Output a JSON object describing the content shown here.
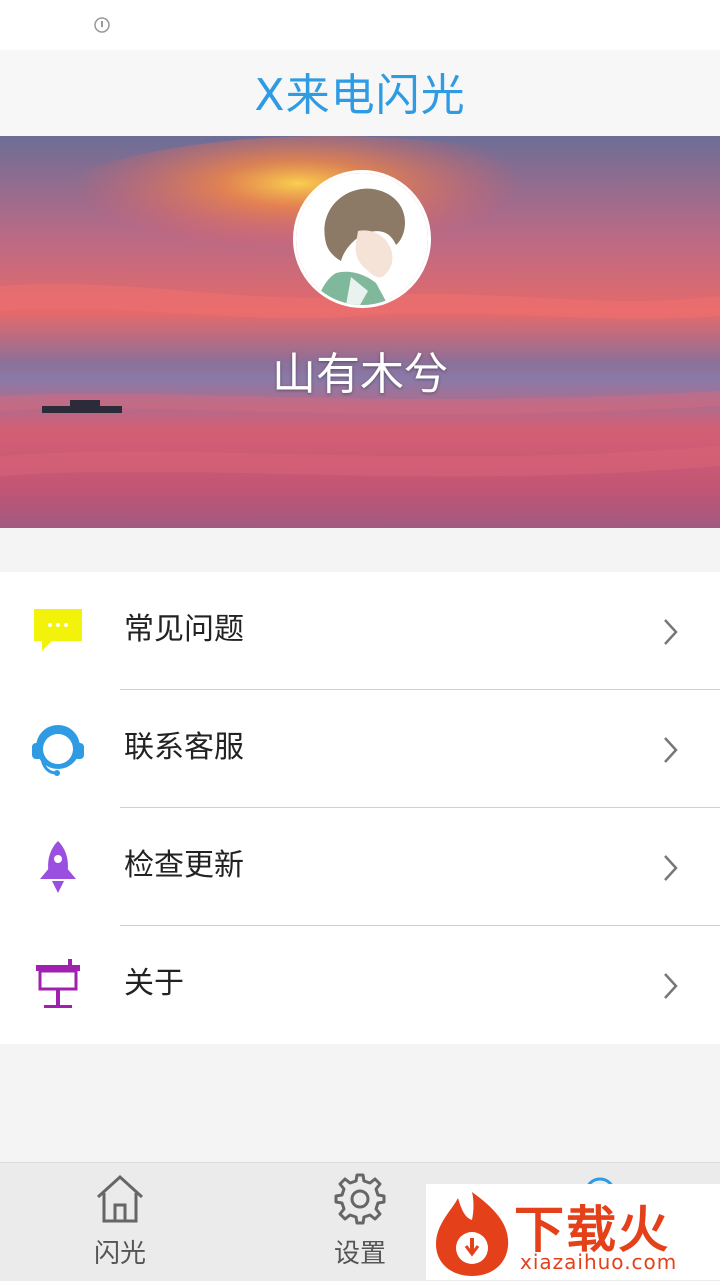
{
  "app": {
    "title": "X来电闪光"
  },
  "profile": {
    "username": "山有木兮"
  },
  "menu": {
    "items": [
      {
        "label": "常见问题",
        "icon": "chat-bubble-icon",
        "color": "#f2f20a"
      },
      {
        "label": "联系客服",
        "icon": "headset-icon",
        "color": "#2f9be3"
      },
      {
        "label": "检查更新",
        "icon": "rocket-icon",
        "color": "#9b4fe0"
      },
      {
        "label": "关于",
        "icon": "presentation-board-icon",
        "color": "#a020b0"
      }
    ]
  },
  "tabs": [
    {
      "label": "闪光",
      "icon": "home-icon"
    },
    {
      "label": "设置",
      "icon": "gear-icon"
    },
    {
      "label": "",
      "icon": "profile-icon"
    }
  ],
  "watermark": {
    "title": "下载火",
    "site": "xiazaihuo.com"
  },
  "colors": {
    "accent": "#2f9be3",
    "watermark": "#e4401a"
  }
}
